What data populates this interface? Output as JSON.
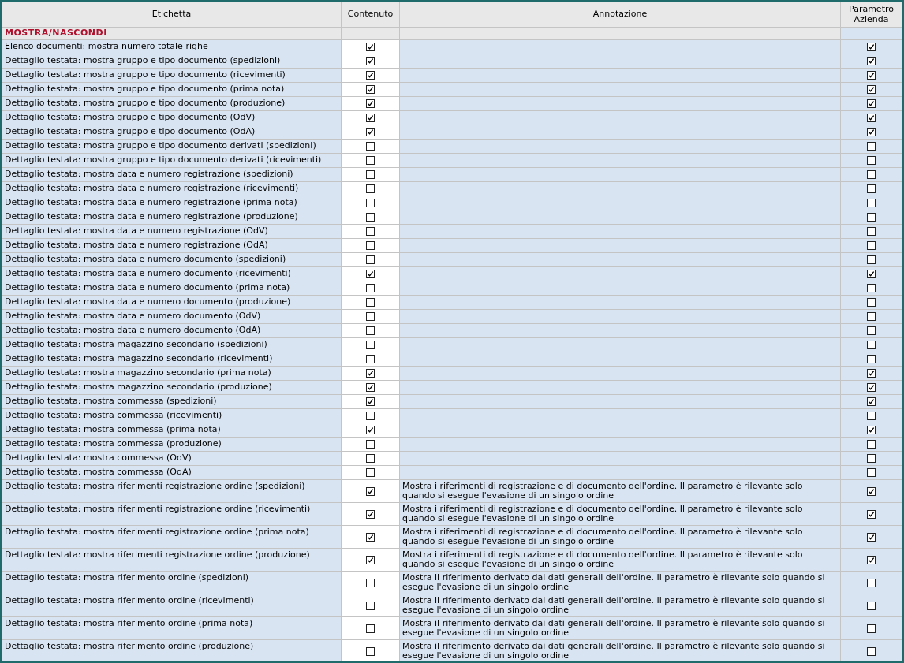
{
  "table": {
    "columns": [
      "Etichetta",
      "Contenuto",
      "Annotazione",
      "Parametro Azienda"
    ],
    "section": "MOSTRA/NASCONDI",
    "rows": [
      {
        "label": "Elenco documenti: mostra numero totale righe",
        "content": true,
        "company": true
      },
      {
        "label": "Dettaglio testata: mostra gruppo e tipo documento (spedizioni)",
        "content": true,
        "company": true
      },
      {
        "label": "Dettaglio testata: mostra gruppo e tipo documento (ricevimenti)",
        "content": true,
        "company": true
      },
      {
        "label": "Dettaglio testata: mostra gruppo e tipo documento (prima nota)",
        "content": true,
        "company": true
      },
      {
        "label": "Dettaglio testata: mostra gruppo e tipo documento (produzione)",
        "content": true,
        "company": true
      },
      {
        "label": "Dettaglio testata: mostra gruppo e tipo documento (OdV)",
        "content": true,
        "company": true
      },
      {
        "label": "Dettaglio testata: mostra gruppo e tipo documento (OdA)",
        "content": true,
        "company": true
      },
      {
        "label": "Dettaglio testata: mostra gruppo e tipo documento derivati (spedizioni)",
        "content": false,
        "company": false
      },
      {
        "label": "Dettaglio testata: mostra gruppo e tipo documento derivati (ricevimenti)",
        "content": false,
        "company": false
      },
      {
        "label": "Dettaglio testata: mostra data e numero registrazione (spedizioni)",
        "content": false,
        "company": false
      },
      {
        "label": "Dettaglio testata: mostra data e numero registrazione (ricevimenti)",
        "content": false,
        "company": false
      },
      {
        "label": "Dettaglio testata: mostra data e numero registrazione (prima nota)",
        "content": false,
        "company": false
      },
      {
        "label": "Dettaglio testata: mostra data e numero registrazione (produzione)",
        "content": false,
        "company": false
      },
      {
        "label": "Dettaglio testata: mostra data e numero registrazione (OdV)",
        "content": false,
        "company": false
      },
      {
        "label": "Dettaglio testata: mostra data e numero registrazione (OdA)",
        "content": false,
        "company": false
      },
      {
        "label": "Dettaglio testata: mostra data e numero documento (spedizioni)",
        "content": false,
        "company": false
      },
      {
        "label": "Dettaglio testata: mostra data e numero documento (ricevimenti)",
        "content": true,
        "company": true
      },
      {
        "label": "Dettaglio testata: mostra data e numero documento (prima nota)",
        "content": false,
        "company": false
      },
      {
        "label": "Dettaglio testata: mostra data e numero documento (produzione)",
        "content": false,
        "company": false
      },
      {
        "label": "Dettaglio testata: mostra data e numero documento (OdV)",
        "content": false,
        "company": false
      },
      {
        "label": "Dettaglio testata: mostra data e numero documento (OdA)",
        "content": false,
        "company": false
      },
      {
        "label": "Dettaglio testata: mostra magazzino secondario (spedizioni)",
        "content": false,
        "company": false
      },
      {
        "label": "Dettaglio testata: mostra magazzino secondario (ricevimenti)",
        "content": false,
        "company": false
      },
      {
        "label": "Dettaglio testata: mostra magazzino secondario (prima nota)",
        "content": true,
        "company": true
      },
      {
        "label": "Dettaglio testata: mostra magazzino secondario (produzione)",
        "content": true,
        "company": true
      },
      {
        "label": "Dettaglio testata: mostra commessa (spedizioni)",
        "content": true,
        "company": true
      },
      {
        "label": "Dettaglio testata: mostra commessa (ricevimenti)",
        "content": false,
        "company": false
      },
      {
        "label": "Dettaglio testata: mostra commessa (prima nota)",
        "content": true,
        "company": true
      },
      {
        "label": "Dettaglio testata: mostra commessa (produzione)",
        "content": false,
        "company": false
      },
      {
        "label": "Dettaglio testata: mostra commessa (OdV)",
        "content": false,
        "company": false
      },
      {
        "label": "Dettaglio testata: mostra commessa (OdA)",
        "content": false,
        "company": false
      },
      {
        "label": "Dettaglio testata: mostra riferimenti registrazione ordine (spedizioni)",
        "content": true,
        "note": "Mostra i riferimenti di registrazione e di documento dell'ordine. Il parametro è rilevante solo quando si esegue l'evasione di un singolo ordine",
        "company": true
      },
      {
        "label": "Dettaglio testata: mostra riferimenti registrazione ordine (ricevimenti)",
        "content": true,
        "note": "Mostra i riferimenti di registrazione e di documento dell'ordine. Il parametro è rilevante solo quando si esegue l'evasione di un singolo ordine",
        "company": true
      },
      {
        "label": "Dettaglio testata: mostra riferimenti registrazione ordine (prima nota)",
        "content": true,
        "note": "Mostra i riferimenti di registrazione e di documento dell'ordine. Il parametro è rilevante solo quando si esegue l'evasione di un singolo ordine",
        "company": true
      },
      {
        "label": "Dettaglio testata: mostra riferimenti registrazione ordine (produzione)",
        "content": true,
        "note": "Mostra i riferimenti di registrazione e di documento dell'ordine. Il parametro è rilevante solo quando si esegue l'evasione di un singolo ordine",
        "company": true
      },
      {
        "label": "Dettaglio testata: mostra riferimento ordine (spedizioni)",
        "content": false,
        "note": "Mostra il riferimento derivato dai dati generali dell'ordine. Il parametro è rilevante solo quando si esegue l'evasione di un singolo ordine",
        "company": false
      },
      {
        "label": "Dettaglio testata: mostra riferimento ordine (ricevimenti)",
        "content": false,
        "note": "Mostra il riferimento derivato dai dati generali dell'ordine. Il parametro è rilevante solo quando si esegue l'evasione di un singolo ordine",
        "company": false
      },
      {
        "label": "Dettaglio testata: mostra riferimento ordine (prima nota)",
        "content": false,
        "note": "Mostra il riferimento derivato dai dati generali dell'ordine. Il parametro è rilevante solo quando si esegue l'evasione di un singolo ordine",
        "company": false
      },
      {
        "label": "Dettaglio testata: mostra riferimento ordine (produzione)",
        "content": false,
        "note": "Mostra il riferimento derivato dai dati generali dell'ordine. Il parametro è rilevante solo quando si esegue l'evasione di un singolo ordine",
        "company": false
      }
    ]
  }
}
